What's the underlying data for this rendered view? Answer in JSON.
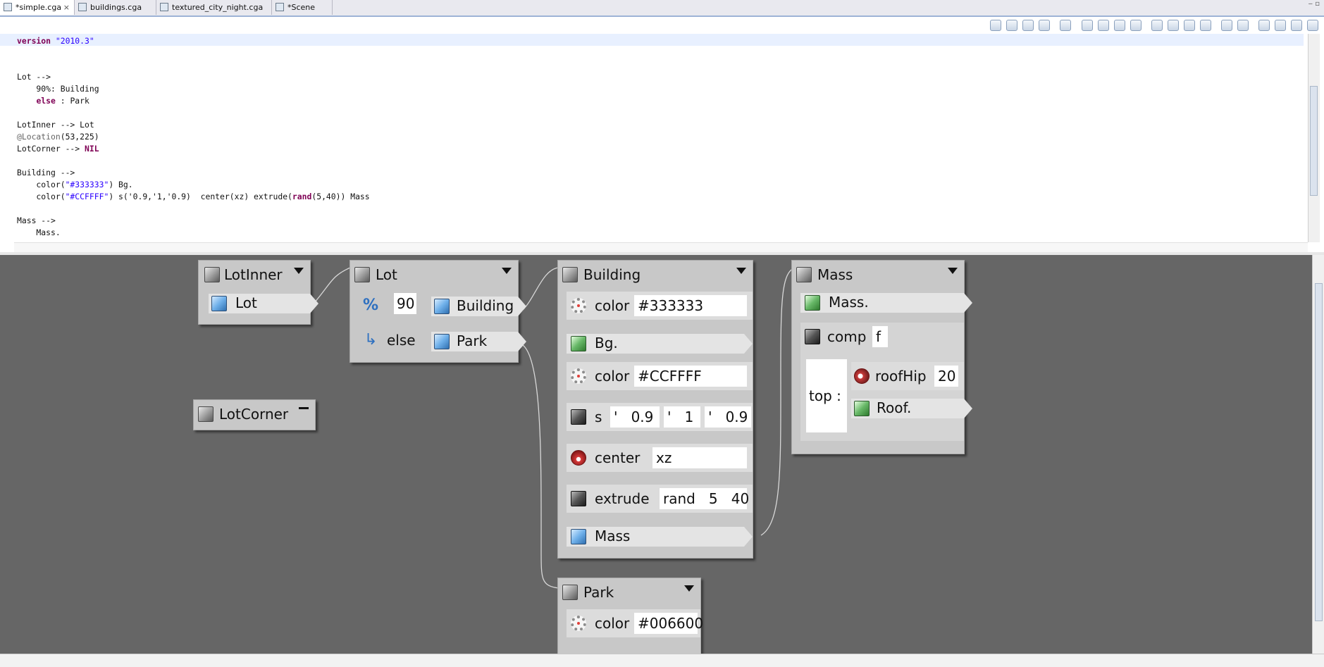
{
  "tabs": [
    {
      "label": "*simple.cga",
      "active": true,
      "close": "×"
    },
    {
      "label": "buildings.cga"
    },
    {
      "label": "textured_city_night.cga"
    },
    {
      "label": "*Scene"
    }
  ],
  "window_controls": "‒ ▫",
  "editor": {
    "lines": [
      "version \"2010.3\"",
      "",
      "",
      "Lot -->",
      "    90%: Building",
      "    else : Park",
      "",
      "LotInner --> Lot",
      "@Location(53,225)",
      "LotCorner --> NIL",
      "",
      "Building -->",
      "    color(\"#333333\") Bg.",
      "    color(\"#CCFFFF\") s('0.9,'1,'0.9)  center(xz) extrude(rand(5,40)) Mass",
      "",
      "Mass -->",
      "    Mass."
    ]
  },
  "graph": {
    "lotinner": {
      "title": "LotInner",
      "successor": "Lot"
    },
    "lotcorner": {
      "title": "LotCorner"
    },
    "lot": {
      "title": "Lot",
      "percent_symbol": "%",
      "percent_value": "90",
      "percent_target": "Building",
      "else_label": "else",
      "else_target": "Park"
    },
    "building": {
      "title": "Building",
      "color1_label": "color",
      "color1_value": "#333333",
      "bg_label": "Bg.",
      "color2_label": "color",
      "color2_value": "#CCFFFF",
      "s_label": "s",
      "s_q1": "'",
      "s_v1": "0.9",
      "s_q2": "'",
      "s_v2": "1",
      "s_q3": "'",
      "s_v3": "0.9",
      "center_label": "center",
      "center_value": "xz",
      "extrude_label": "extrude",
      "extrude_value": "rand   5   40",
      "mass_label": "Mass"
    },
    "mass": {
      "title": "Mass",
      "mass_label": "Mass.",
      "comp_label": "comp",
      "comp_value": "f",
      "top_label": "top  :",
      "roofhip_label": "roofHip",
      "roofhip_value": "20",
      "roof_label": "Roof."
    },
    "park": {
      "title": "Park",
      "color_label": "color",
      "color_value": "#006600"
    }
  }
}
